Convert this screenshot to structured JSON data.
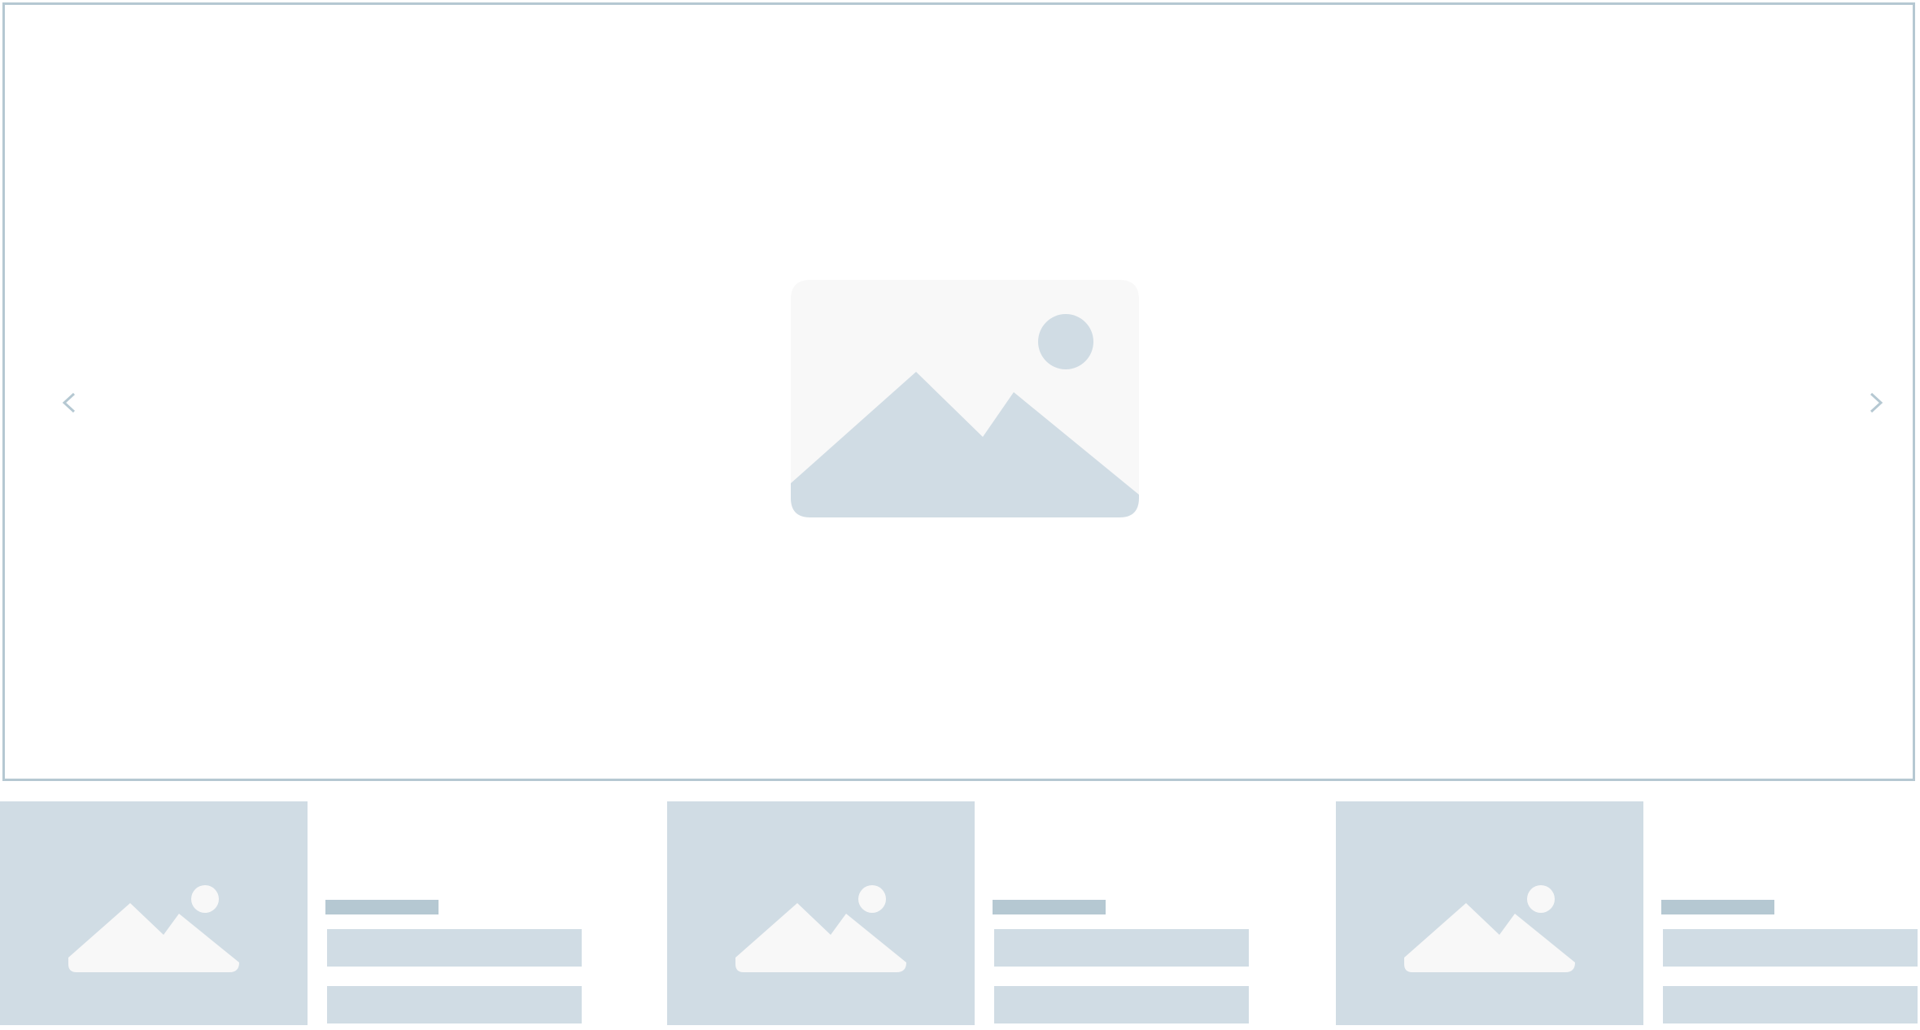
{
  "colors": {
    "frame_border": "#b5c8d2",
    "placeholder_fill": "#d0dce4",
    "placeholder_light": "#f8f8f8",
    "title_bar": "#b5c8d2"
  },
  "carousel": {
    "hero_icon": "image-placeholder-icon",
    "prev_icon": "chevron-left-icon",
    "next_icon": "chevron-right-icon"
  },
  "cards": [
    {
      "thumb_icon": "image-placeholder-icon"
    },
    {
      "thumb_icon": "image-placeholder-icon"
    },
    {
      "thumb_icon": "image-placeholder-icon"
    }
  ]
}
